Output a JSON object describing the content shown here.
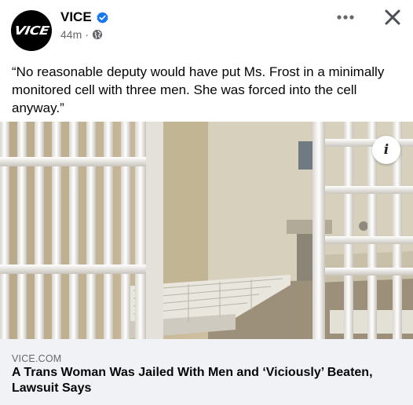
{
  "post": {
    "avatar_text": "VICE",
    "page_name": "VICE",
    "time": "44m",
    "separator": "·",
    "text": "“No reasonable deputy would have put Ms. Frost in a minimally monitored cell with three men. She was forced into the cell anyway.”"
  },
  "icons": {
    "verified": "verified-badge-icon",
    "audience": "globe-icon",
    "more": "more-options-icon",
    "close": "close-icon",
    "info": "info-icon"
  },
  "link": {
    "domain": "VICE.COM",
    "title": "A Trans Woman Was Jailed With Men and ‘Viciously’ Beaten, Lawsuit Says"
  },
  "image": {
    "info_label": "i"
  },
  "colors": {
    "verified_blue": "#1877f2",
    "secondary_text": "#65676b",
    "footer_bg": "#f0f2f5"
  }
}
